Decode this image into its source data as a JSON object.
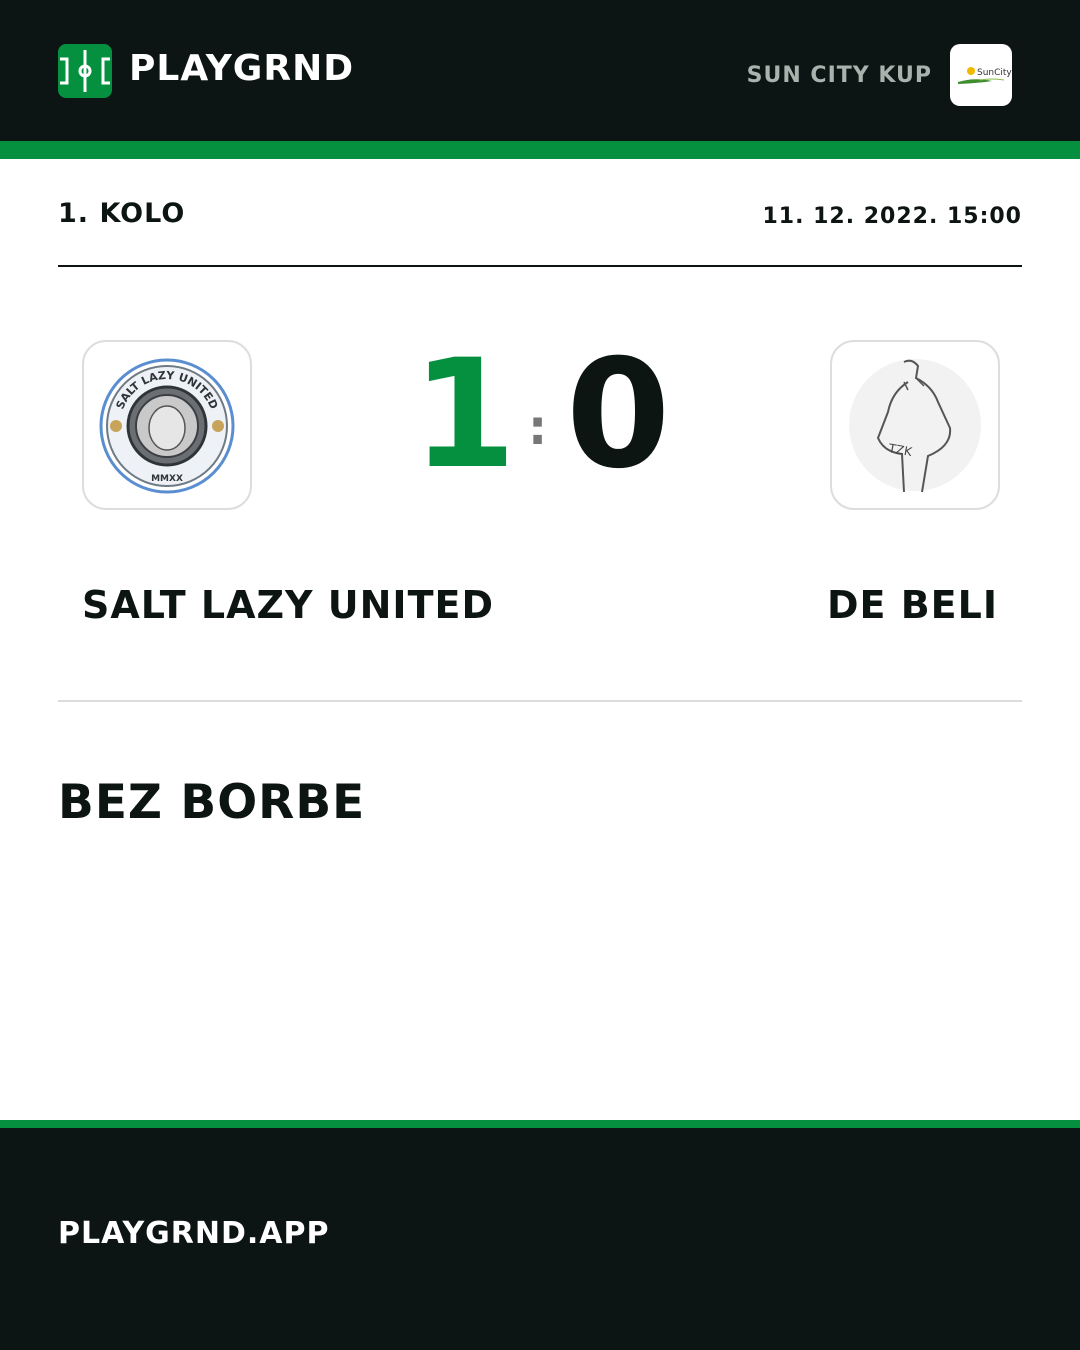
{
  "header": {
    "brand": "PLAYGRND",
    "competition": "SUN CITY KUP",
    "competition_logo_text": "SunCity"
  },
  "match": {
    "round": "1. KOLO",
    "datetime": "11. 12. 2022. 15:00",
    "home": {
      "name": "SALT LAZY UNITED",
      "score": "1",
      "logo_arc_text": "SALT LAZY UNITED",
      "logo_bottom_text": "MMXX"
    },
    "separator": ":",
    "away": {
      "name": "DE BELI",
      "score": "0",
      "logo_text": "TZK"
    },
    "status": "BEZ BORBE"
  },
  "footer": {
    "url": "PLAYGRND.APP"
  },
  "colors": {
    "accent": "#05903f",
    "dark": "#0c1513",
    "muted": "#a9b2ad"
  }
}
